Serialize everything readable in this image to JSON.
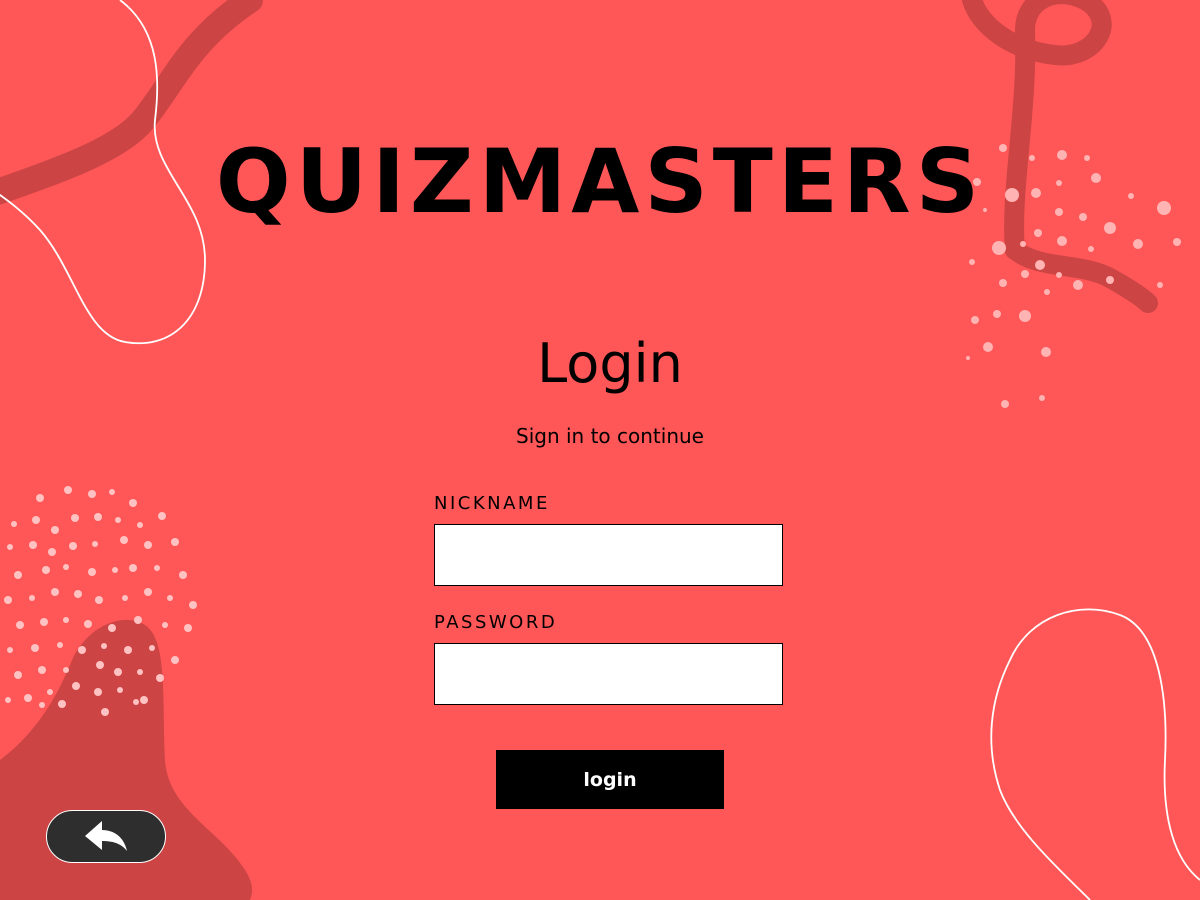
{
  "app": {
    "title": "QUIZMASTERS"
  },
  "login": {
    "heading": "Login",
    "subtitle": "Sign in to continue",
    "nickname_label": "NICKNAME",
    "nickname_value": "",
    "password_label": "PASSWORD",
    "password_value": "",
    "submit_label": "login"
  },
  "navigation": {
    "back_icon": "back-arrow-icon"
  },
  "colors": {
    "background": "#ff5757",
    "decor_dark": "#cc4444",
    "button": "#000000",
    "back_button": "#2e2e2e"
  }
}
